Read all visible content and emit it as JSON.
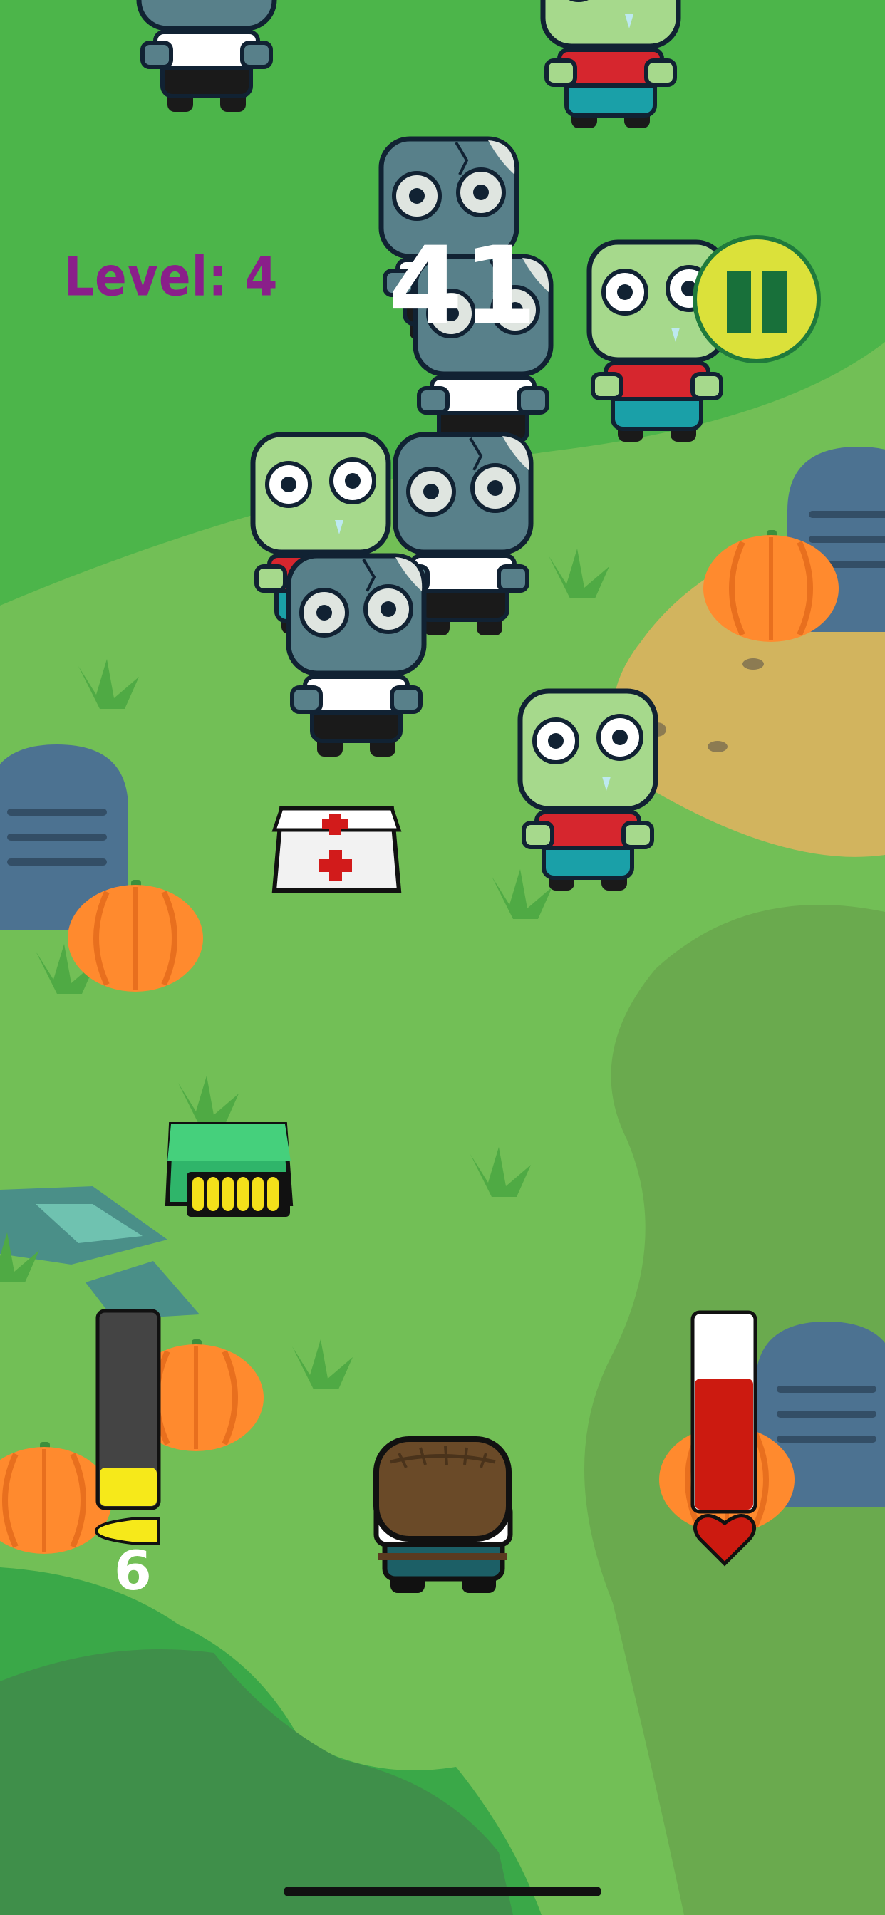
{
  "hud": {
    "level_label": "Level: 4",
    "score": "41",
    "ammo_count": "6",
    "ammo_level": 0.2,
    "health_level": 0.67,
    "pause_icon": "pause-icon"
  },
  "colors": {
    "grass": "#4cb54a",
    "grass_light": "#72bf56",
    "grass_dark": "#3f9a4a",
    "path": "#d2b45e",
    "level_text": "#8a1f8a",
    "pause_bg": "#dbe13a",
    "pause_fg": "#18703a",
    "ammo_fill": "#f6e91a",
    "health_fill": "#cc1a10"
  },
  "objects": {
    "pickups": [
      "medkit",
      "ammo-box"
    ],
    "player": "player-character",
    "zombie_count": 9
  }
}
